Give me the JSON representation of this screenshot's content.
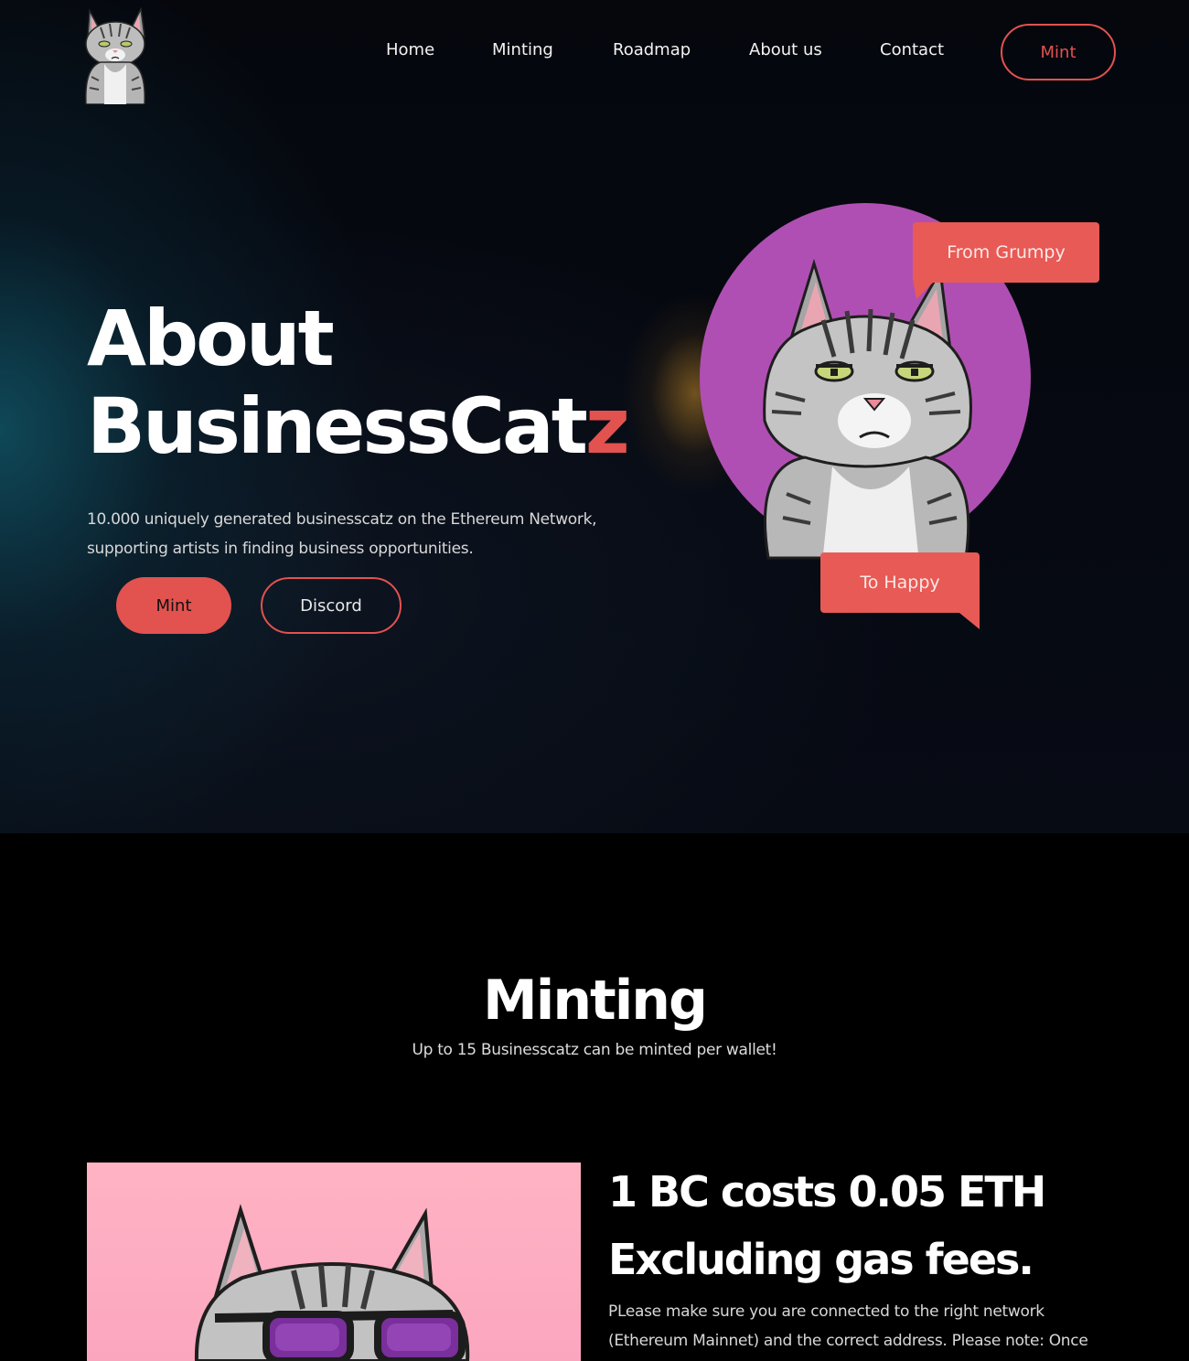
{
  "nav": {
    "links": [
      "Home",
      "Minting",
      "Roadmap",
      "About us",
      "Contact"
    ],
    "mint_label": "Mint"
  },
  "hero": {
    "title_line1": "About",
    "title_line2_main": "BusinessCat",
    "title_line2_accent": "z",
    "description": "10.000 uniquely generated businesscatz on the Ethereum Network, supporting artists in finding business opportunities.",
    "mint_label": "Mint",
    "discord_label": "Discord",
    "bubble_top": "From Grumpy",
    "bubble_bottom": "To Happy"
  },
  "minting": {
    "title": "Minting",
    "subtitle": "Up to 15 Businesscatz can be minted per wallet!",
    "price_line1": "1 BC costs 0.05 ETH",
    "price_line2": "Excluding gas fees.",
    "notice": "PLease make sure you are connected to the right network (Ethereum Mainnet) and the correct address. Please note: Once"
  },
  "colors": {
    "accent": "#e2524f",
    "bubble": "#e85a55",
    "circle": "#b04fb3",
    "mint_panel": "#fba6bf"
  },
  "icons": {
    "logo": "cat-logo-icon",
    "hero_art": "grumpy-cat-illustration",
    "mint_art": "cat-sunglasses-illustration"
  }
}
